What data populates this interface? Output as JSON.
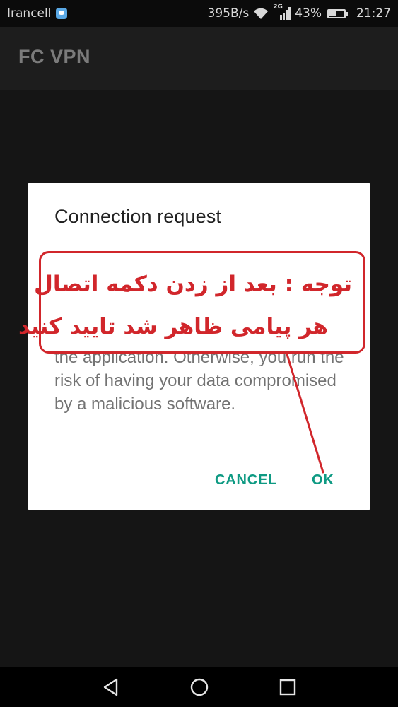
{
  "status_bar": {
    "carrier": "Irancell",
    "speed": "395B/s",
    "network": "2G",
    "battery": "43%",
    "battery_level": 0.43,
    "time": "21:27",
    "icons": [
      "chat-notification-icon",
      "wifi-icon",
      "signal-icon",
      "battery-icon"
    ]
  },
  "app_bar": {
    "title": "FC VPN"
  },
  "dialog": {
    "title": "Connection request",
    "body_visible": "the application. Otherwise, you run the risk of having your data compromised by a malicious software.",
    "cancel_label": "CANCEL",
    "ok_label": "OK"
  },
  "annotation": {
    "line1": "توجه : بعد از زدن دکمه اتصال",
    "line2": "هر پیامی ظاهر شد تایید کنید",
    "color": "#d1262b"
  },
  "nav_bar": {
    "icons": [
      "back-icon",
      "home-icon",
      "recents-icon"
    ]
  },
  "colors": {
    "accent": "#0e9a83",
    "annotation": "#d1262b"
  }
}
